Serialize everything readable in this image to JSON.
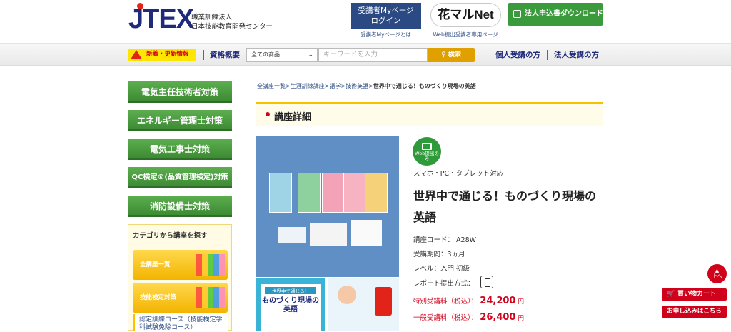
{
  "header": {
    "logo_text": "JTEX",
    "org_line1": "職業訓練法人",
    "org_line2": "日本技能教育開発センター",
    "mypage_line1": "受講者Myページ",
    "mypage_line2": "ログイン",
    "mypage_sub": "受講者Myページとは",
    "hana_logo": "花マルNet",
    "hana_sub": "Web提出受講者専用ページ",
    "download_label": "法人申込書ダウンロード"
  },
  "nav": {
    "news_label": "新着・更新情報",
    "qualification_link": "資格概要",
    "select_value": "全ての商品",
    "keyword_placeholder": "キーワードを入力",
    "search_label": "検索",
    "individual_link": "個人受講の方",
    "corporate_link": "法人受講の方"
  },
  "sidebar": {
    "buttons": [
      "電気主任技術者対策",
      "エネルギー管理士対策",
      "電気工事士対策",
      "QC検定®(品質管理検定)対策",
      "消防設備士対策"
    ],
    "category_title": "カテゴリから講座を探す",
    "category_items": [
      "全講座一覧",
      "技能検定対策"
    ],
    "sub_item": "認定訓練コース（技能検定学科試験免除コース）"
  },
  "breadcrumb": {
    "items": [
      "全講座一覧",
      "生涯訓練講座",
      "語学",
      "技術英語"
    ],
    "current": "世界中で通じる！ものづくり現場の英語"
  },
  "section_title": "講座詳細",
  "product": {
    "web_badge": "Web提出のみ",
    "devices": "スマホ・PC・タブレット対応",
    "title": "世界中で通じる！ものづくり現場の英語",
    "code_label": "講座コード：",
    "code": "A28W",
    "period_label": "受講期間：",
    "period": "3ヵ月",
    "level_label": "レベル：",
    "level": "入門 初級",
    "report_label": "レポート提出方式：",
    "special_price_label": "特別受講料（税込）：",
    "special_price": "24,200",
    "general_price_label": "一般受講料（税込）：",
    "general_price": "26,400",
    "currency": "円",
    "thumb_book_title": "ものづくり現場の英語",
    "thumb_book_top": "世界中で通じる！"
  },
  "floating": {
    "to_top": "上へ",
    "cart": "買い物カート",
    "apply": "お申し込みはこちら"
  }
}
